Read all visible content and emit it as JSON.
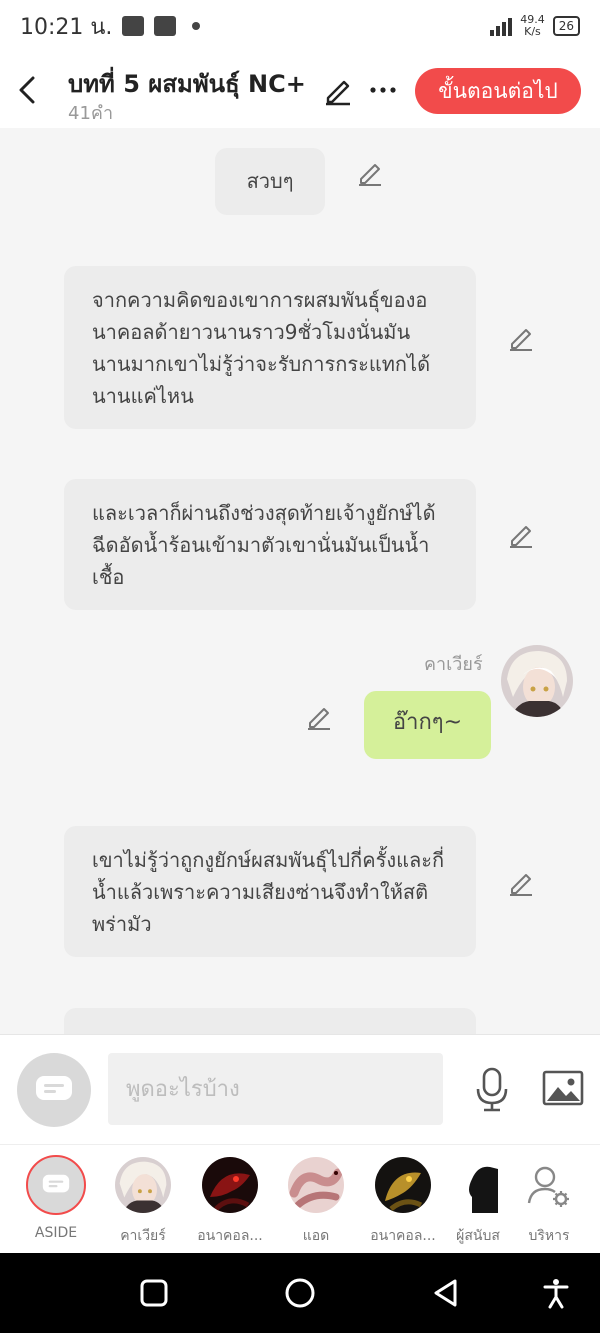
{
  "status": {
    "time": "10:21 น.",
    "speed_top": "49.4",
    "speed_bottom": "K/s",
    "battery": "26"
  },
  "header": {
    "title": "บทที่ 5 ผสมพันธุ์ NC+",
    "word_count": "41คำ",
    "next_label": "ขั้นตอนต่อไป"
  },
  "messages": [
    {
      "type": "aside",
      "text": "สวบๆ"
    },
    {
      "type": "aside",
      "text": "จากความคิดของเขาการผสมพันธุ์ของอนาคอลด้ายาวนานราว9ชั่วโมงนั่นมันนานมากเขาไม่รู้ว่าจะรับการกระแทกได้นานแค่ไหน"
    },
    {
      "type": "aside",
      "text": "และเวลาก็ผ่านถึงช่วงสุดท้ายเจ้างูยักษ์ได้ฉีดอัดน้ำร้อนเข้ามาตัวเขานั่นมันเป็นน้ำเชื้อ"
    },
    {
      "type": "character",
      "speaker": "คาเวียร์",
      "text": "อ๊ากๆ~"
    },
    {
      "type": "aside",
      "text": "เขาไม่รู้ว่าถูกงูยักษ์ผสมพันธุ์ไปกี่ครั้งและกี่น้ำแล้วเพราะความเสียงซ่านจึงทำให้สติพร่ามัว"
    }
  ],
  "input": {
    "placeholder": "พูดอะไรบ้าง"
  },
  "characters": [
    {
      "label": "ASIDE"
    },
    {
      "label": "คาเวียร์"
    },
    {
      "label": "อนาคอล..."
    },
    {
      "label": "แอด"
    },
    {
      "label": "อนาคอล..."
    },
    {
      "label": "ผู้สนับส"
    },
    {
      "label": "บริหาร"
    }
  ],
  "colors": {
    "accent": "#f24b4b",
    "character_bubble": "#d5f09a",
    "aside_bubble": "#ececec"
  }
}
